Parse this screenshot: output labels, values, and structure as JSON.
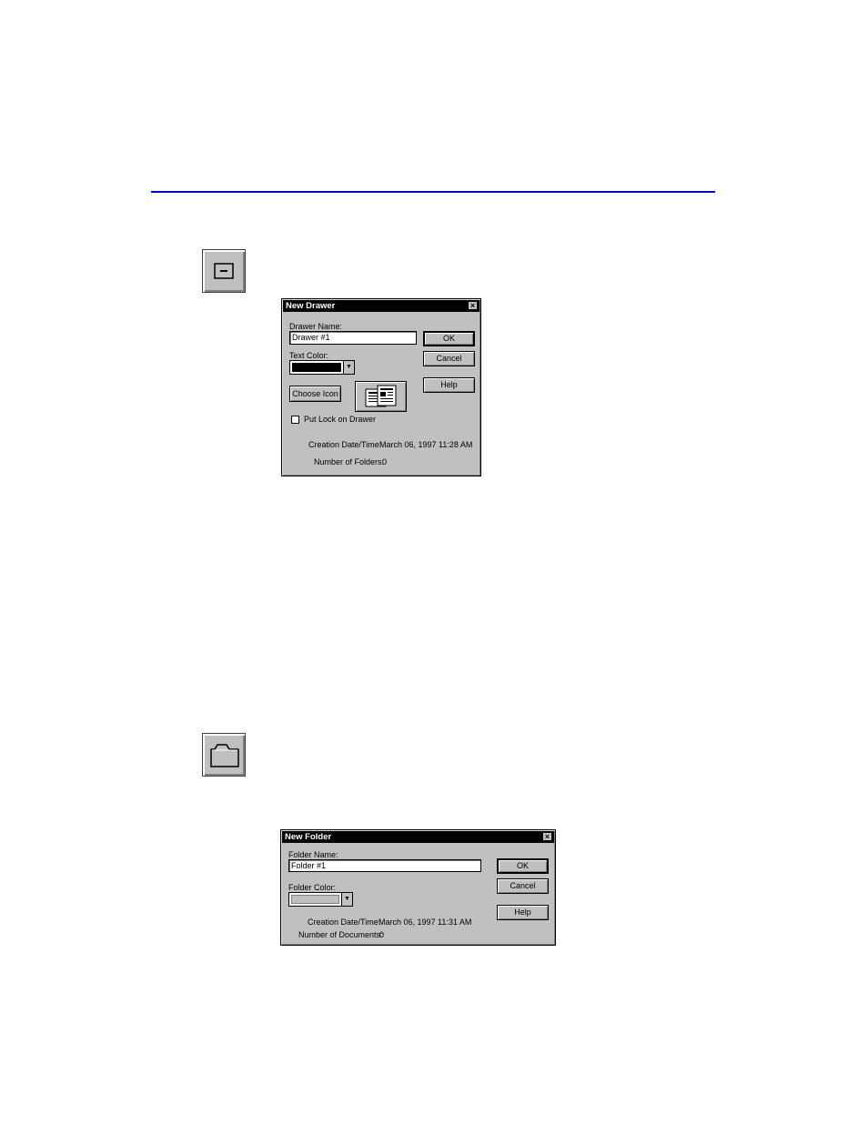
{
  "drawer_dialog": {
    "title": "New Drawer",
    "name_label": "Drawer Name:",
    "name_value": "Drawer #1",
    "text_color_label": "Text Color:",
    "text_color": "#000000",
    "choose_icon_label": "Choose Icon",
    "lock_label": "Put Lock on Drawer",
    "lock_checked": false,
    "creation_label": "Creation Date/Time:",
    "creation_value": "March 06, 1997 11:28 AM",
    "folders_label": "Number of Folders:",
    "folders_value": "0",
    "ok_label": "OK",
    "cancel_label": "Cancel",
    "help_label": "Help"
  },
  "folder_dialog": {
    "title": "New Folder",
    "name_label": "Folder Name:",
    "name_value": "Folder #1",
    "folder_color_label": "Folder Color:",
    "folder_color": "#c0c0c0",
    "creation_label": "Creation Date/Time:",
    "creation_value": "March 06, 1997 11:31 AM",
    "documents_label": "Number of Documents:",
    "documents_value": "0",
    "ok_label": "OK",
    "cancel_label": "Cancel",
    "help_label": "Help"
  },
  "icons": {
    "drawer_tool": "drawer-icon",
    "folder_tool": "folder-icon",
    "drawer_preview": "drawer-preview-icon"
  },
  "colors": {
    "rule": "#0000c8",
    "dialog_face": "#c0c0c0",
    "titlebar": "#000000"
  }
}
